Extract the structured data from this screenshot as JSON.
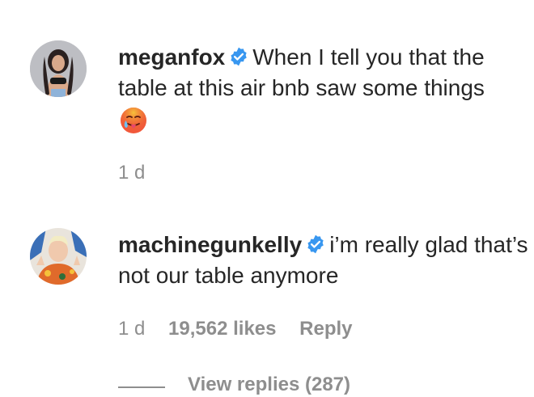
{
  "comments": [
    {
      "username": "meganfox",
      "text": "When I tell you that the table at this air bnb saw some things",
      "time": "1 d"
    },
    {
      "username": "machinegunkelly",
      "text": "i’m really glad that’s not our table anymore",
      "time": "1 d",
      "likes": "19,562 likes",
      "reply_label": "Reply"
    }
  ],
  "view_replies": "View replies (287)",
  "colors": {
    "text": "#262626",
    "secondary": "#8e8e8e",
    "verified": "#3897f0"
  }
}
